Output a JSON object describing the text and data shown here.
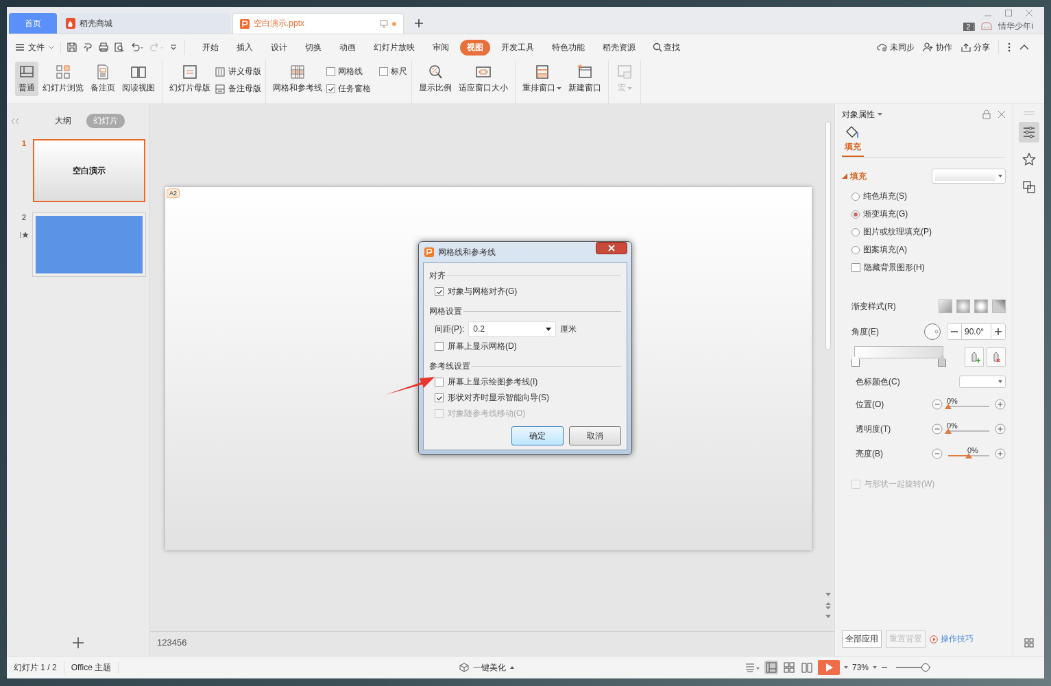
{
  "tabs": [
    {
      "label": "首页",
      "kind": "home",
      "selected": false,
      "unsaved": false
    },
    {
      "label": "稻壳商城",
      "kind": "store",
      "selected": false,
      "unsaved": false
    },
    {
      "label": "空白演示.pptx",
      "kind": "doc",
      "selected": true,
      "unsaved": true
    }
  ],
  "account": {
    "badge": "2",
    "name": "情华少年i"
  },
  "file_menu": "文件",
  "menu": [
    {
      "label": "开始",
      "selected": false
    },
    {
      "label": "插入",
      "selected": false
    },
    {
      "label": "设计",
      "selected": false
    },
    {
      "label": "切换",
      "selected": false
    },
    {
      "label": "动画",
      "selected": false
    },
    {
      "label": "幻灯片放映",
      "selected": false
    },
    {
      "label": "审阅",
      "selected": false
    },
    {
      "label": "视图",
      "selected": true
    },
    {
      "label": "开发工具",
      "selected": false
    },
    {
      "label": "特色功能",
      "selected": false
    },
    {
      "label": "稻壳资源",
      "selected": false
    }
  ],
  "search": "查找",
  "actions": [
    "未同步",
    "协作",
    "分享"
  ],
  "ribbon": [
    {
      "items": [
        {
          "kind": "big",
          "label": "普通",
          "selected": true,
          "dropdown": false,
          "disabled": false
        },
        {
          "kind": "big",
          "label": "幻灯片浏览",
          "selected": false,
          "dropdown": false,
          "disabled": false
        },
        {
          "kind": "big",
          "label": "备注页",
          "selected": false,
          "dropdown": false,
          "disabled": false
        },
        {
          "kind": "big",
          "label": "阅读视图",
          "selected": false,
          "dropdown": false,
          "disabled": false
        }
      ]
    },
    {
      "items": [
        {
          "kind": "big",
          "label": "幻灯片母版",
          "selected": false,
          "dropdown": false,
          "disabled": false
        },
        {
          "kind": "small",
          "label": "讲义母版"
        },
        {
          "kind": "small",
          "label": "备注母版"
        }
      ]
    },
    {
      "items": [
        {
          "kind": "big",
          "label": "网格和参考线",
          "selected": false,
          "dropdown": false,
          "disabled": false
        },
        {
          "kind": "check",
          "label": "网格线",
          "checked": false
        },
        {
          "kind": "check",
          "label": "任务窗格",
          "checked": true
        },
        {
          "kind": "check",
          "label": "标尺",
          "checked": false
        }
      ]
    },
    {
      "items": [
        {
          "kind": "big",
          "label": "显示比例",
          "selected": false,
          "dropdown": false,
          "disabled": false
        },
        {
          "kind": "big",
          "label": "适应窗口大小",
          "selected": false,
          "dropdown": false,
          "disabled": false
        }
      ]
    },
    {
      "items": [
        {
          "kind": "big",
          "label": "重排窗口",
          "selected": false,
          "dropdown": true,
          "disabled": false
        },
        {
          "kind": "big",
          "label": "新建窗口",
          "selected": false,
          "dropdown": false,
          "disabled": false
        }
      ]
    },
    {
      "items": [
        {
          "kind": "big",
          "label": "宏",
          "selected": false,
          "dropdown": true,
          "disabled": true
        }
      ]
    }
  ],
  "view_tabs": [
    {
      "label": "大纲",
      "selected": false
    },
    {
      "label": "幻灯片",
      "selected": true
    }
  ],
  "slides": [
    {
      "number": "1",
      "kind": "title",
      "title": "空白演示",
      "selected": true,
      "animated": false
    },
    {
      "number": "2",
      "kind": "blue",
      "selected": false,
      "animated": true
    }
  ],
  "comment_badge": "A2",
  "notes": "123456",
  "dialog": {
    "title": "网格线和参考线",
    "sections": [
      {
        "title": "对齐",
        "items": [
          {
            "kind": "check",
            "label": "对象与网格对齐(G)",
            "checked": true,
            "disabled": false
          }
        ]
      },
      {
        "title": "网格设置",
        "items": [
          {
            "kind": "select",
            "label": "间距(P):",
            "value": "0.2",
            "unit": "厘米"
          },
          {
            "kind": "check",
            "label": "屏幕上显示网格(D)",
            "checked": false,
            "disabled": false
          }
        ]
      },
      {
        "title": "参考线设置",
        "items": [
          {
            "kind": "check",
            "label": "屏幕上显示绘图参考线(I)",
            "checked": false,
            "disabled": false
          },
          {
            "kind": "check",
            "label": "形状对齐时显示智能向导(S)",
            "checked": true,
            "disabled": false
          },
          {
            "kind": "check",
            "label": "对象随参考线移动(O)",
            "checked": false,
            "disabled": true
          }
        ]
      }
    ],
    "buttons": [
      {
        "label": "确定",
        "kind": "primary"
      },
      {
        "label": "取消",
        "kind": "normal"
      }
    ]
  },
  "panel": {
    "title": "对象属性",
    "tab": "填充",
    "section": "填充",
    "options": [
      {
        "kind": "radio",
        "label": "纯色填充(S)",
        "selected": false
      },
      {
        "kind": "radio",
        "label": "渐变填充(G)",
        "selected": true
      },
      {
        "kind": "radio",
        "label": "图片或纹理填充(P)",
        "selected": false
      },
      {
        "kind": "radio",
        "label": "图案填充(A)",
        "selected": false
      },
      {
        "kind": "check",
        "label": "隐藏背景图形(H)",
        "checked": false
      }
    ],
    "gradient_style": "渐变样式(R)",
    "angle": {
      "label": "角度(E)",
      "value": "90.0°"
    },
    "stop_color": "色标颜色(C)",
    "sliders": [
      {
        "label": "位置(O)",
        "reading": "0%",
        "level": 0
      },
      {
        "label": "透明度(T)",
        "reading": "0%",
        "level": 0
      },
      {
        "label": "亮度(B)",
        "reading": "0%",
        "level": 0.5
      }
    ],
    "rotate": {
      "label": "与形状一起旋转(W)",
      "checked": false,
      "disabled": true
    },
    "buttons": [
      {
        "label": "全部应用",
        "disabled": false
      },
      {
        "label": "重置背景",
        "disabled": true
      }
    ],
    "tips": "操作技巧"
  },
  "status": {
    "slide": "幻灯片 1 / 2",
    "theme": "Office 主题",
    "beautify": "一键美化",
    "zoom": "73%",
    "zoom_slider": {
      "level": 0.85
    }
  }
}
